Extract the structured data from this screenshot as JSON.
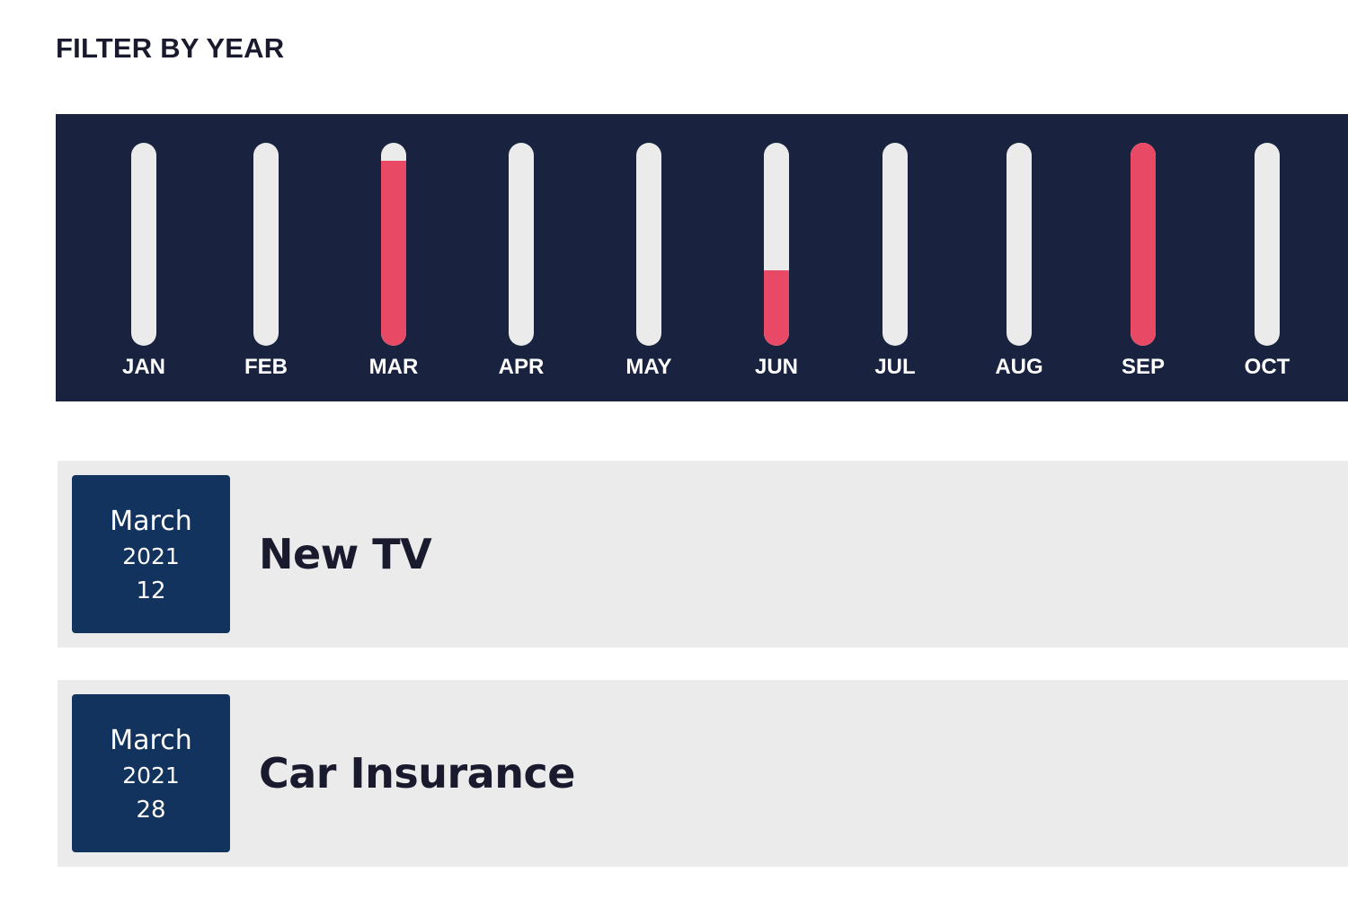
{
  "filter": {
    "title": "FILTER BY YEAR"
  },
  "colors": {
    "panel_bg": "#19223f",
    "track": "#ebebeb",
    "fill": "#e84a66",
    "date_box_bg": "#12335e",
    "item_bg": "#ebebeb",
    "text_dark": "#1a1a2e"
  },
  "chart_data": {
    "type": "bar",
    "categories": [
      "JAN",
      "FEB",
      "MAR",
      "APR",
      "MAY",
      "JUN",
      "JUL",
      "AUG",
      "SEP",
      "OCT"
    ],
    "values": [
      0,
      0,
      0.91,
      0,
      0,
      0.37,
      0,
      0,
      1.0,
      0
    ],
    "ylim": [
      0,
      1
    ],
    "grid": false
  },
  "expenses": [
    {
      "month": "March",
      "year": "2021",
      "day": "12",
      "title": "New TV"
    },
    {
      "month": "March",
      "year": "2021",
      "day": "28",
      "title": "Car Insurance"
    }
  ]
}
